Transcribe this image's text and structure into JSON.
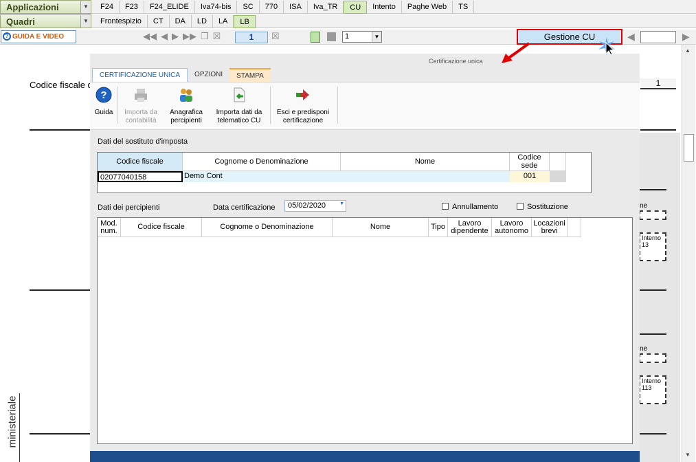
{
  "topbar": {
    "menu1_label": "Applicazioni",
    "menu2_label": "Quadri",
    "tabs": [
      "F24",
      "F23",
      "F24_ELIDE",
      "Iva74-bis",
      "SC",
      "770",
      "ISA",
      "Iva_TR",
      "CU",
      "Intento",
      "Paghe Web",
      "TS"
    ],
    "active_tab": "CU",
    "subtabs": [
      "Frontespizio",
      "CT",
      "DA",
      "LD",
      "LA",
      "LB"
    ],
    "active_subtab": "LB"
  },
  "toolbar": {
    "guida_label": "GUIDA E VIDEO",
    "page_number": "1",
    "select_value": "1",
    "gestione_label": "Gestione CU"
  },
  "background_doc": {
    "codice_label": "Codice fiscale de",
    "page_value": "1",
    "side_label": "ministeriale",
    "r_label1": "ne",
    "r_label2": "ne",
    "interno1_label": "Interno",
    "interno1_value": "13",
    "interno2_label": "Interno",
    "interno2_value": "113"
  },
  "dialog": {
    "title": "Certificazione unica",
    "tabs": [
      "CERTIFICAZIONE UNICA",
      "OPZIONI",
      "STAMPA"
    ],
    "ribbon": {
      "guida": "Guida",
      "importa_line1": "Importa da",
      "importa_line2": "contabilità",
      "anagrafica_line1": "Anagrafica",
      "anagrafica_line2": "percipienti",
      "telematico_line1": "Importa dati da",
      "telematico_line2": "telematico CU",
      "esci_line1": "Esci e predisponi",
      "esci_line2": "certificazione"
    },
    "sostituto": {
      "section_label": "Dati del sostituto d'imposta",
      "headers": {
        "codice_fiscale": "Codice fiscale",
        "cognome": "Cognome o Denominazione",
        "nome": "Nome",
        "codice_sede_line1": "Codice",
        "codice_sede_line2": "sede"
      },
      "row": {
        "codice_fiscale": "02077040158",
        "cognome": "Demo Cont",
        "nome": "",
        "codice_sede": "001"
      }
    },
    "percipienti": {
      "section_label": "Dati dei percipienti",
      "data_label": "Data certificazione",
      "data_value": "05/02/2020",
      "annullamento_label": "Annullamento",
      "sostituzione_label": "Sostituzione",
      "headers": {
        "mod_line1": "Mod.",
        "mod_line2": "num.",
        "codice_fiscale": "Codice fiscale",
        "cognome": "Cognome o Denominazione",
        "nome": "Nome",
        "tipo": "Tipo",
        "lav_dip_line1": "Lavoro",
        "lav_dip_line2": "dipendente",
        "lav_aut_line1": "Lavoro",
        "lav_aut_line2": "autonomo",
        "loc_line1": "Locazioni",
        "loc_line2": "brevi"
      }
    }
  },
  "colors": {
    "highlight_border": "#e00000",
    "accent_blue": "#1d5db5",
    "dialog_footer": "#1e4e8c"
  }
}
